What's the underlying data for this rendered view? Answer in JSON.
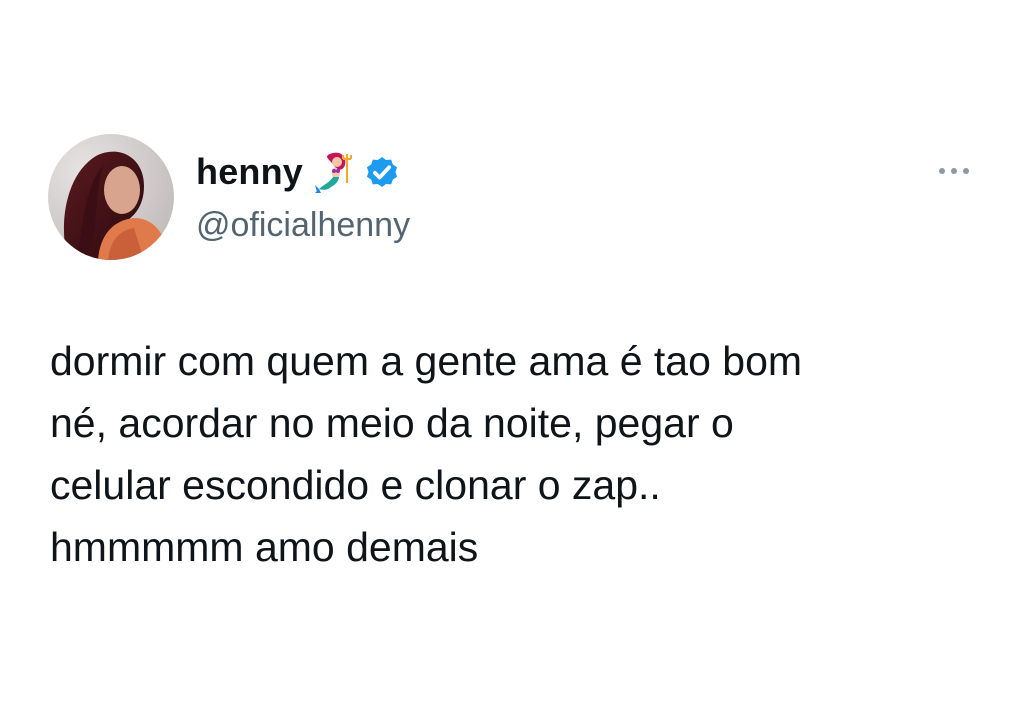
{
  "author": {
    "display_name": "henny",
    "name_emoji_icon": "mermaid-emoji-icon",
    "verified_icon": "verified-badge-icon",
    "verified_color": "#1d9bf0",
    "handle": "@oficialhenny"
  },
  "menu": {
    "more_icon": "more-options-icon"
  },
  "tweet": {
    "text": "dormir com quem a gente ama é tao bom\nné, acordar no meio da noite, pegar o\ncelular escondido e clonar o zap..\nhmmmmm amo demais"
  },
  "colors": {
    "text_primary": "#0f1419",
    "text_secondary": "#536471",
    "background": "#ffffff"
  }
}
